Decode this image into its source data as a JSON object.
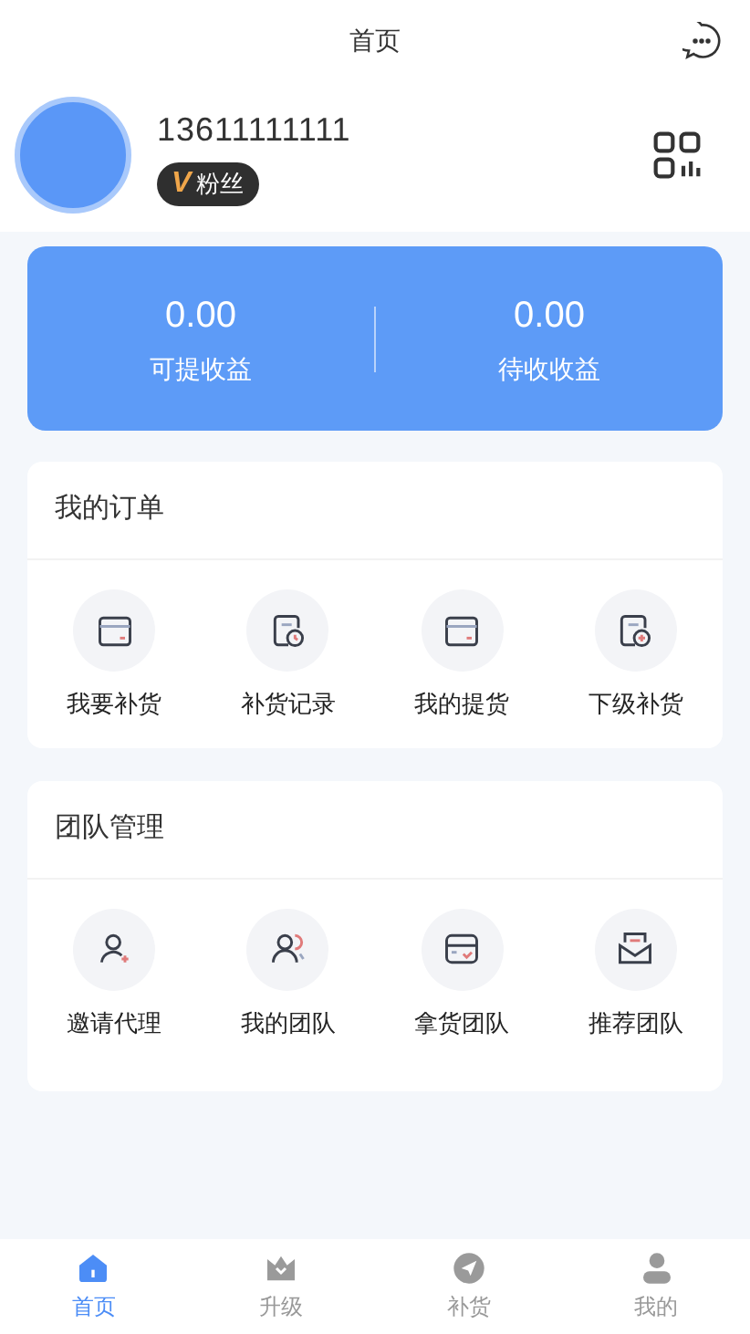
{
  "header": {
    "title": "首页"
  },
  "profile": {
    "phone": "13611111111",
    "badge_mark": "V",
    "badge_label": "粉丝"
  },
  "balances": [
    {
      "value": "0.00",
      "label": "可提收益"
    },
    {
      "value": "0.00",
      "label": "待收收益"
    }
  ],
  "sections": [
    {
      "title": "我的订单",
      "items": [
        {
          "label": "我要补货",
          "kind": "card"
        },
        {
          "label": "补货记录",
          "kind": "record"
        },
        {
          "label": "我的提货",
          "kind": "card"
        },
        {
          "label": "下级补货",
          "kind": "add-record"
        }
      ]
    },
    {
      "title": "团队管理",
      "items": [
        {
          "label": "邀请代理",
          "kind": "invite"
        },
        {
          "label": "我的团队",
          "kind": "team"
        },
        {
          "label": "拿货团队",
          "kind": "box"
        },
        {
          "label": "推荐团队",
          "kind": "mail"
        }
      ]
    }
  ],
  "tabs": [
    {
      "label": "首页",
      "kind": "home",
      "selected": true
    },
    {
      "label": "升级",
      "kind": "crown",
      "selected": false
    },
    {
      "label": "补货",
      "kind": "send",
      "selected": false
    },
    {
      "label": "我的",
      "kind": "user",
      "selected": false
    }
  ]
}
